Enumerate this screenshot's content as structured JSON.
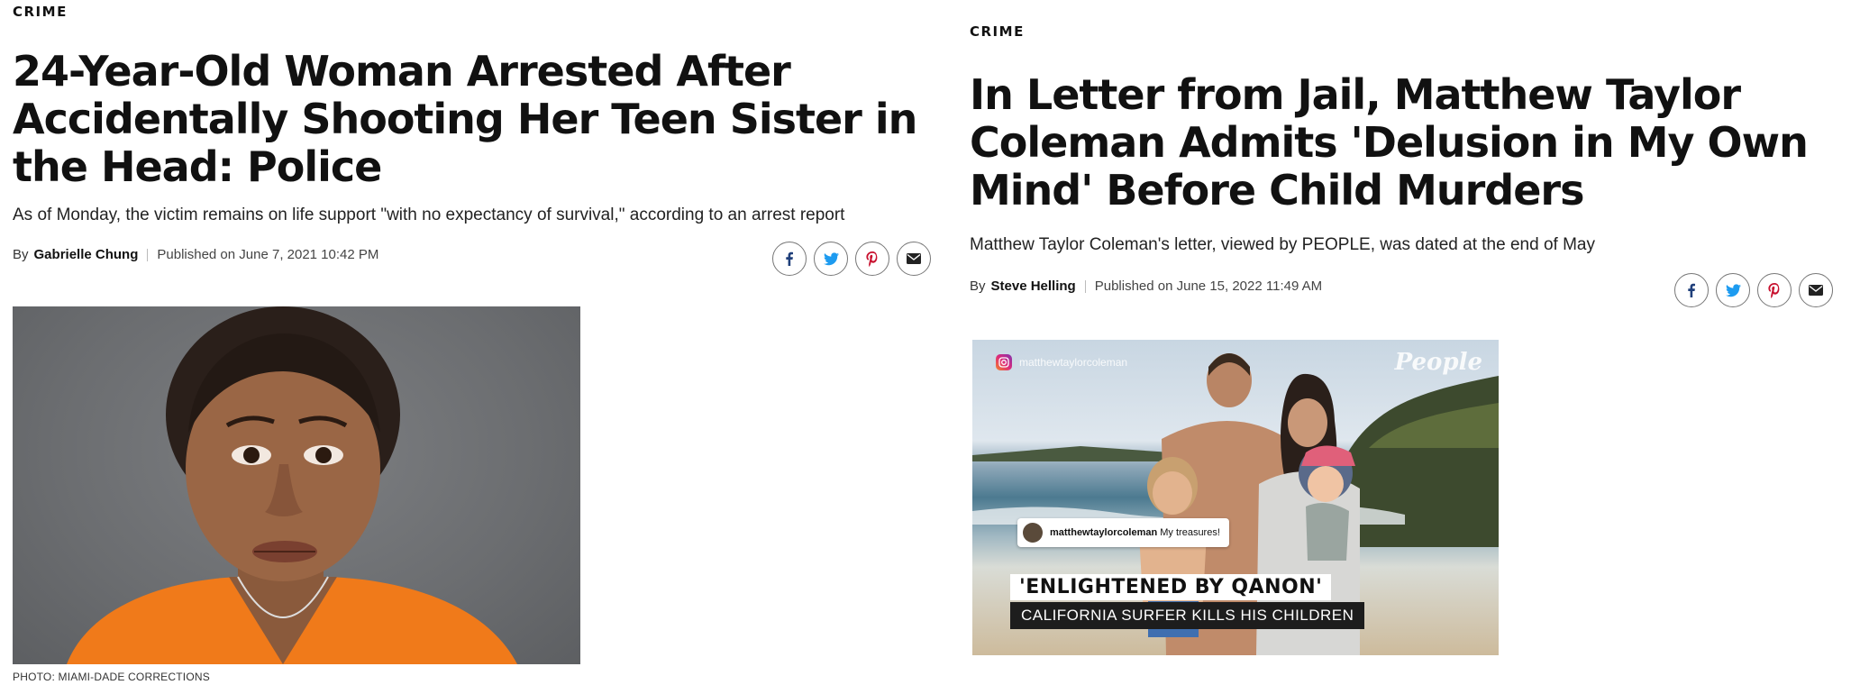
{
  "left_article": {
    "category": "CRIME",
    "headline": "24-Year-Old Woman Arrested After Accidentally Shooting Her Teen Sister in the Head: Police",
    "subhead": "As of Monday, the victim remains on life support \"with no expectancy of survival,\" according to an arrest report",
    "byline_prefix": "By",
    "author": "Gabrielle Chung",
    "published": "Published on June 7, 2021 10:42 PM",
    "photo_caption": "PHOTO: MIAMI-DADE CORRECTIONS"
  },
  "right_article": {
    "category": "CRIME",
    "headline": "In Letter from Jail, Matthew Taylor Coleman Admits 'Delusion in My Own Mind' Before Child Murders",
    "subhead": "Matthew Taylor Coleman's letter, viewed by PEOPLE, was dated at the end of May",
    "byline_prefix": "By",
    "author": "Steve Helling",
    "published": "Published on June 15, 2022 11:49 AM",
    "video": {
      "instagram_handle": "matthewtaylorcoleman",
      "watermark": "People",
      "comment_user": "matthewtaylorcoleman",
      "comment_text": "My treasures!",
      "chyron_title": "'ENLIGHTENED BY QANON'",
      "chyron_sub": "CALIFORNIA SURFER KILLS HIS CHILDREN"
    }
  },
  "share_icons": [
    "facebook-icon",
    "twitter-icon",
    "pinterest-icon",
    "email-icon"
  ],
  "colors": {
    "facebook": "#1f3f7a",
    "twitter": "#1d9bf0",
    "pinterest": "#c8102e",
    "email": "#222222",
    "prison_uniform": "#f07a1a"
  }
}
